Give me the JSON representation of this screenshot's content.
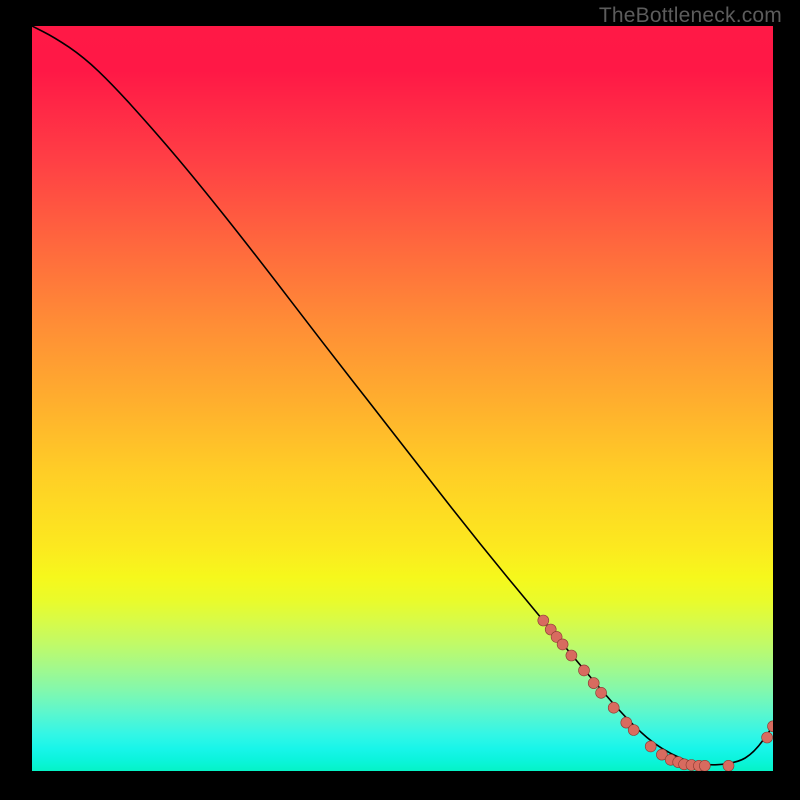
{
  "watermark": "TheBottleneck.com",
  "chart_data": {
    "type": "line",
    "title": "",
    "xlabel": "",
    "ylabel": "",
    "xlim": [
      0,
      1
    ],
    "ylim": [
      0,
      1
    ],
    "series": [
      {
        "name": "curve",
        "x": [
          0.0,
          0.03,
          0.07,
          0.11,
          0.16,
          0.22,
          0.3,
          0.4,
          0.5,
          0.6,
          0.7,
          0.76,
          0.81,
          0.85,
          0.9,
          0.95,
          0.975,
          1.0
        ],
        "y": [
          1.0,
          0.985,
          0.958,
          0.92,
          0.865,
          0.795,
          0.695,
          0.565,
          0.438,
          0.31,
          0.19,
          0.118,
          0.062,
          0.028,
          0.007,
          0.01,
          0.025,
          0.06
        ]
      },
      {
        "name": "markers",
        "x": [
          0.69,
          0.7,
          0.708,
          0.716,
          0.728,
          0.745,
          0.758,
          0.768,
          0.785,
          0.802,
          0.812,
          0.835,
          0.85,
          0.862,
          0.872,
          0.88,
          0.89,
          0.9,
          0.908,
          0.94,
          0.992,
          1.0
        ],
        "y": [
          0.202,
          0.19,
          0.18,
          0.17,
          0.155,
          0.135,
          0.118,
          0.105,
          0.085,
          0.065,
          0.055,
          0.033,
          0.022,
          0.015,
          0.012,
          0.009,
          0.008,
          0.007,
          0.007,
          0.007,
          0.045,
          0.06
        ]
      }
    ],
    "colors": {
      "line": "#000000",
      "marker_fill": "#d86b5f",
      "marker_stroke": "#8a3b33"
    }
  }
}
